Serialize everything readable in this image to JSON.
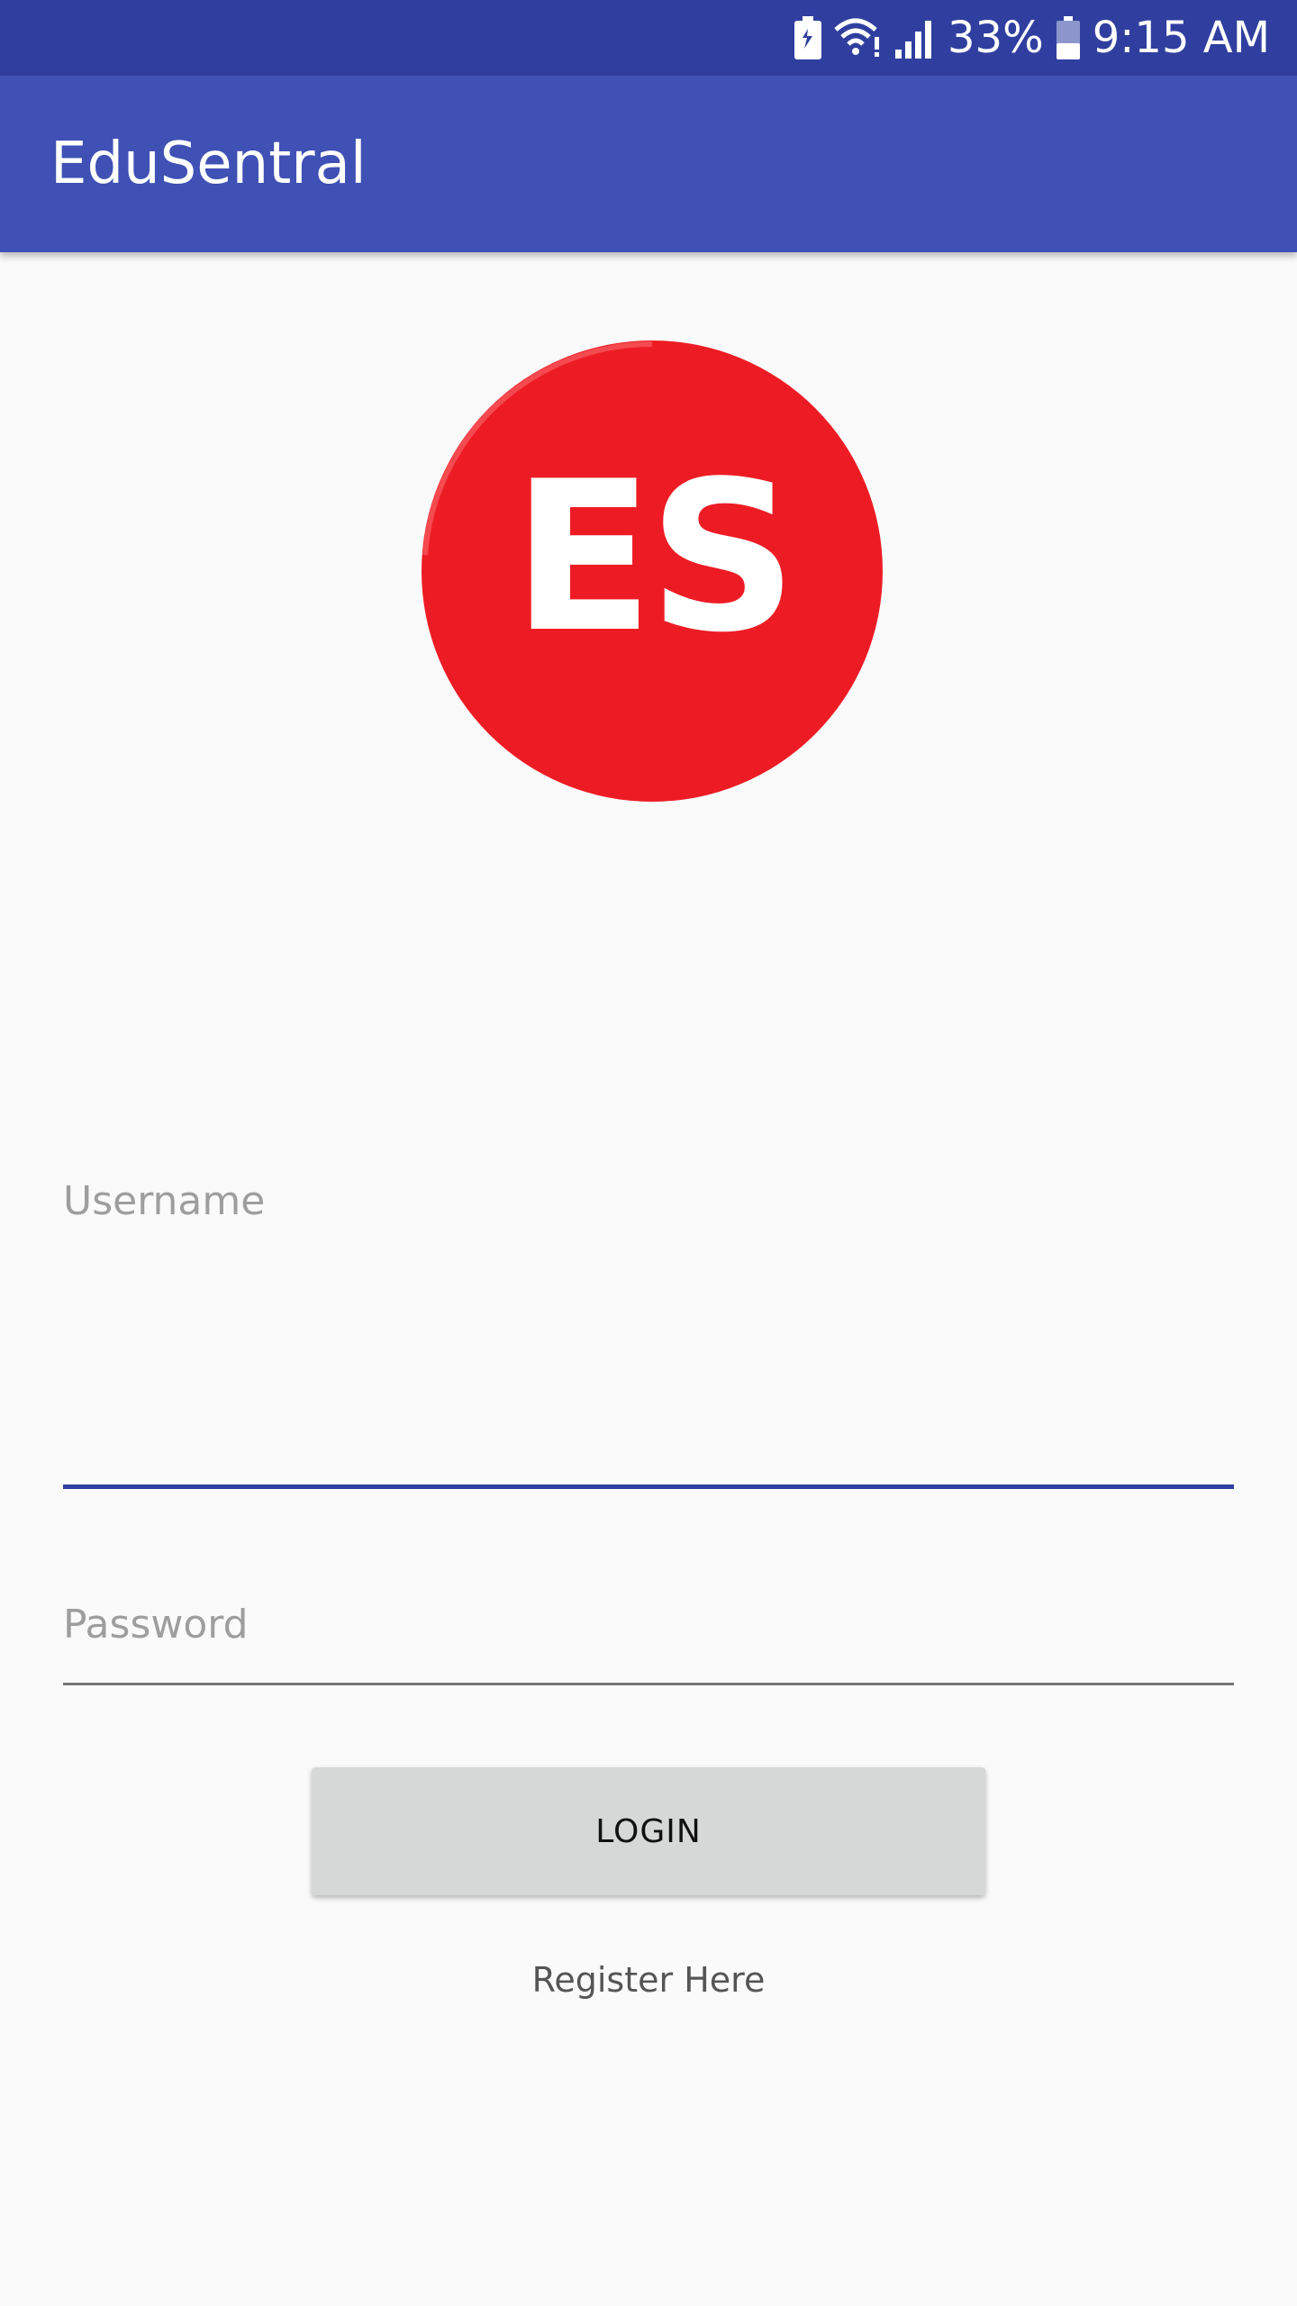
{
  "status_bar": {
    "battery_percent": "33%",
    "time": "9:15 AM",
    "icons": [
      "battery-saver-icon",
      "wifi-icon",
      "signal-icon",
      "battery-icon"
    ]
  },
  "app_bar": {
    "title": "EduSentral"
  },
  "logo": {
    "text": "ES",
    "color": "#ed1c24"
  },
  "form": {
    "username_placeholder": "Username",
    "password_placeholder": "Password",
    "login_label": "LOGIN",
    "register_label": "Register Here"
  },
  "colors": {
    "status_bar": "#303f9f",
    "app_bar": "#3f51b5",
    "accent": "#303f9f",
    "background": "#fafafa"
  }
}
